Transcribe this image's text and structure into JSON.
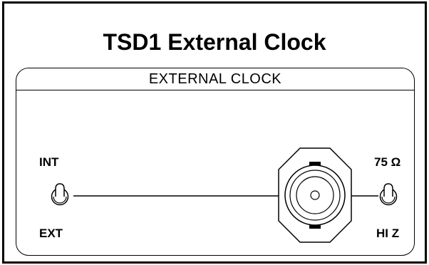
{
  "title": "TSD1 External Clock",
  "panel": {
    "heading": "EXTERNAL  CLOCK",
    "left_switch": {
      "top_label": "INT",
      "bottom_label": "EXT"
    },
    "right_switch": {
      "top_label": "75 Ω",
      "bottom_label": "HI Z"
    }
  },
  "colors": {
    "stroke": "#000000",
    "background": "#ffffff"
  },
  "icons": [
    "toggle-switch-icon",
    "bnc-connector-icon"
  ]
}
